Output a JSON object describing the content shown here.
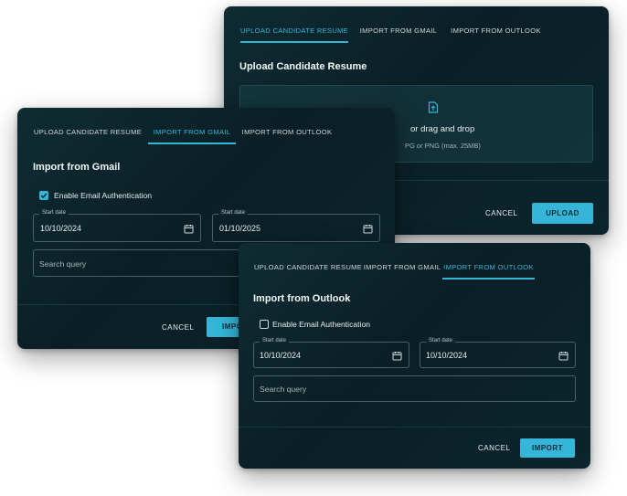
{
  "upload_dialog": {
    "tabs": [
      {
        "label": "UPLOAD CANDIDATE RESUME"
      },
      {
        "label": "IMPORT FROM GMAIL"
      },
      {
        "label": "IMPORT FROM OUTLOOK"
      }
    ],
    "active_tab": 0,
    "title": "Upload Candidate Resume",
    "dropzone": {
      "icon": "file-upload-icon",
      "text": "or drag and drop",
      "subtext": "PG or PNG (max. 25MB)"
    },
    "cancel_label": "CANCEL",
    "upload_label": "UPLOAD"
  },
  "gmail_dialog": {
    "tabs": [
      {
        "label": "UPLOAD CANDIDATE RESUME"
      },
      {
        "label": "IMPORT FROM GMAIL"
      },
      {
        "label": "IMPORT FROM OUTLOOK"
      }
    ],
    "active_tab": 1,
    "title": "Import from Gmail",
    "auth_checkbox": {
      "label": "Enable Email Authentication",
      "checked": true
    },
    "start_date_1": {
      "label": "Start date",
      "value": "10/10/2024"
    },
    "start_date_2": {
      "label": "Start date",
      "value": "01/10/2025"
    },
    "search": {
      "placeholder": "Search query"
    },
    "cancel_label": "CANCEL",
    "import_label": "IMPO"
  },
  "outlook_dialog": {
    "tabs": [
      {
        "label": "UPLOAD CANDIDATE RESUME"
      },
      {
        "label": "IMPORT FROM GMAIL"
      },
      {
        "label": "IMPORT FROM OUTLOOK"
      }
    ],
    "active_tab": 2,
    "title": "Import from Outlook",
    "auth_checkbox": {
      "label": "Enable Email Authentication",
      "checked": false
    },
    "start_date_1": {
      "label": "Start date",
      "value": "10/10/2024"
    },
    "start_date_2": {
      "label": "Start date",
      "value": "10/10/2024"
    },
    "search": {
      "placeholder": "Search query"
    },
    "cancel_label": "CANCEL",
    "import_label": "IMPORT"
  },
  "colors": {
    "accent": "#35b6d8",
    "dialog_bg": "#0a1f25",
    "text": "#e6eef0"
  }
}
